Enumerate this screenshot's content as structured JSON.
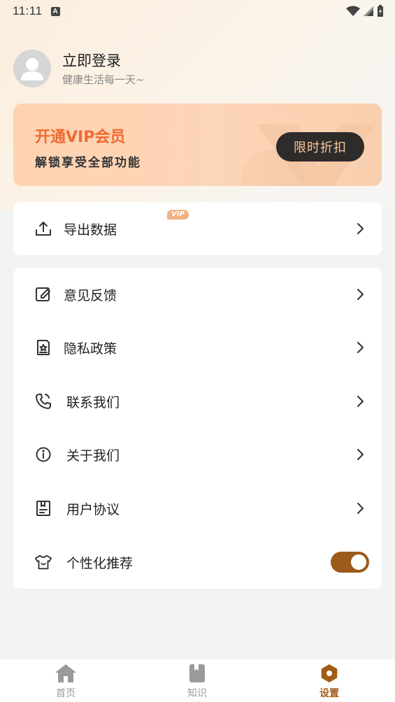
{
  "status_bar": {
    "time": "11:11",
    "badge": "A"
  },
  "profile": {
    "title": "立即登录",
    "subtitle": "健康生活每一天~"
  },
  "vip_card": {
    "title": "开通VIP会员",
    "subtitle": "解锁享受全部功能",
    "button": "限时折扣"
  },
  "card1": {
    "items": [
      {
        "label": "导出数据",
        "tag": "VIP",
        "icon": "upload-icon"
      }
    ]
  },
  "card2": {
    "items": [
      {
        "label": "意见反馈",
        "icon": "edit-icon"
      },
      {
        "label": "隐私政策",
        "icon": "document-icon"
      },
      {
        "label": "联系我们",
        "icon": "phone-icon"
      },
      {
        "label": "关于我们",
        "icon": "info-icon"
      },
      {
        "label": "用户协议",
        "icon": "agreement-icon"
      },
      {
        "label": "个性化推荐",
        "icon": "shirt-icon",
        "toggle": true
      }
    ]
  },
  "tabbar": {
    "tabs": [
      {
        "label": "首页",
        "icon": "home-icon"
      },
      {
        "label": "知识",
        "icon": "book-icon"
      },
      {
        "label": "设置",
        "icon": "settings-icon",
        "active": true
      }
    ]
  },
  "colors": {
    "accent": "#9c5a1d",
    "vip_text": "#ee6a30",
    "background": "#f3f3f3"
  }
}
